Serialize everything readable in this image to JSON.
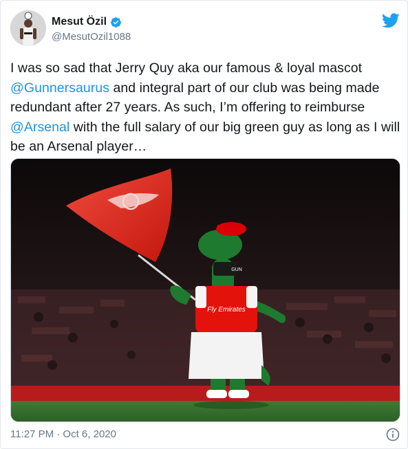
{
  "author": {
    "display_name": "Mesut Özil",
    "handle": "@MesutOzil1088",
    "verified": true
  },
  "tweet": {
    "text_parts": [
      {
        "type": "text",
        "value": "I was so sad that Jerry Quy aka our famous & loyal mascot "
      },
      {
        "type": "mention",
        "value": "@Gunnersaurus"
      },
      {
        "type": "text",
        "value": " and integral part of our club was being made redundant after 27 years. As such, I’m offering to reimburse "
      },
      {
        "type": "mention",
        "value": "@Arsenal"
      },
      {
        "type": "text",
        "value": " with the full salary of our big green guy as long as I will be an Arsenal player…"
      }
    ]
  },
  "media": {
    "shirt_sponsor": "Fly Emirates",
    "collar_text": "GUN"
  },
  "footer": {
    "timestamp": "11:27 PM · Oct 6, 2020"
  },
  "colors": {
    "link": "#1b95e0",
    "muted": "#657786",
    "brand": "#1da1f2",
    "arsenal_red": "#db0007",
    "mascot_green": "#1e7a2e"
  },
  "icons": {
    "verified": "verified-badge-icon",
    "brand": "twitter-bird-icon",
    "info": "info-icon"
  }
}
